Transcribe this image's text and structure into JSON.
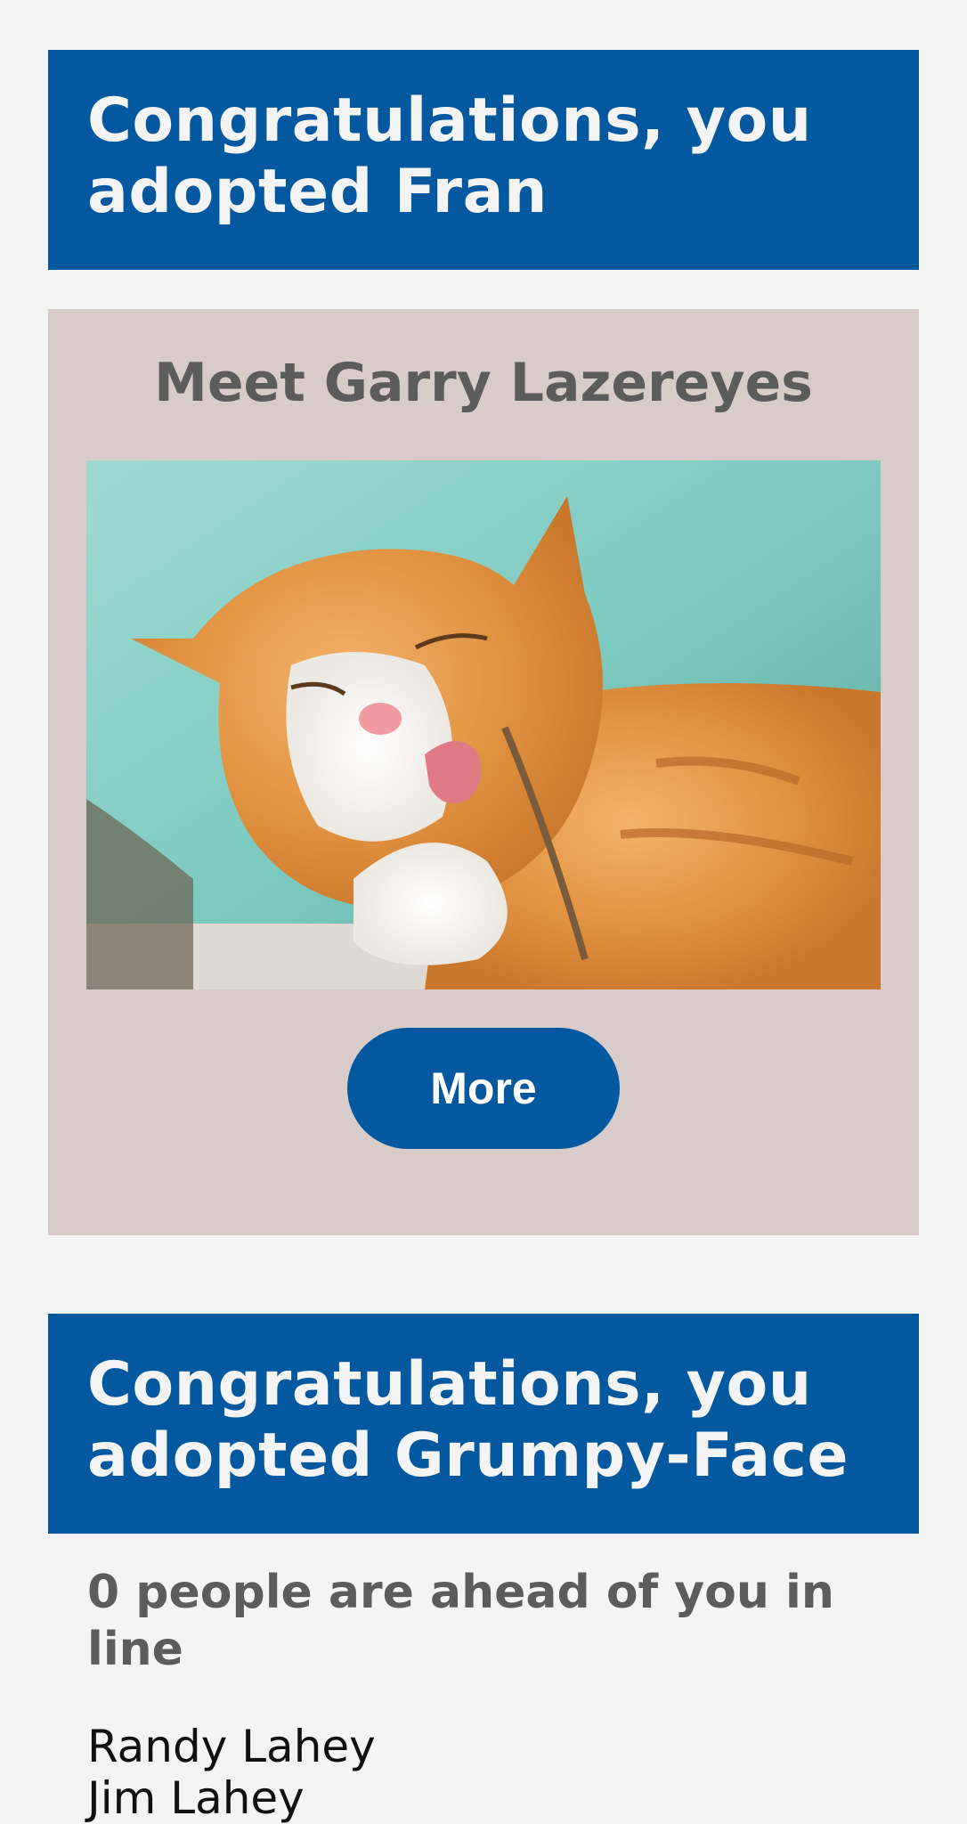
{
  "adoptions": [
    {
      "heading": "Congratulations, you adopted Fran"
    },
    {
      "heading": "Congratulations, you adopted Grumpy-Face"
    }
  ],
  "featured_pet": {
    "title": "Meet Garry Lazereyes",
    "more_label": "More"
  },
  "queue": {
    "status": "0 people are ahead of you in line",
    "names": [
      "Randy Lahey",
      "Jim Lahey"
    ]
  },
  "colors": {
    "banner": "#03589f",
    "card": "#d7ccca",
    "page_background": "#f4f4f4",
    "heading_text": "#5c5c5c"
  }
}
